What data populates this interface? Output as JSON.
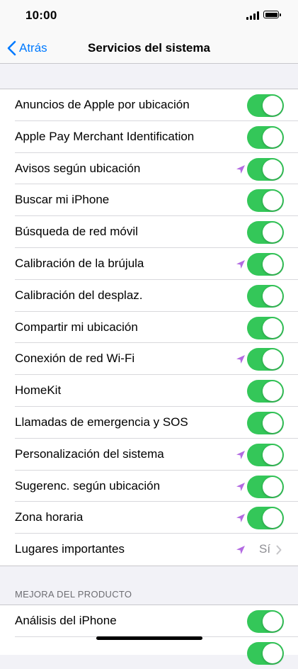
{
  "status": {
    "time": "10:00"
  },
  "nav": {
    "back_label": "Atrás",
    "title": "Servicios del sistema"
  },
  "colors": {
    "accent": "#007aff",
    "toggle_on": "#34c759",
    "location_arrow": "#b36ae2"
  },
  "settings": [
    {
      "label": "Anuncios de Apple por ubicación",
      "on": true,
      "location_icon": false
    },
    {
      "label": "Apple Pay Merchant Identification",
      "on": true,
      "location_icon": false
    },
    {
      "label": "Avisos según ubicación",
      "on": true,
      "location_icon": true
    },
    {
      "label": "Buscar mi iPhone",
      "on": true,
      "location_icon": false
    },
    {
      "label": "Búsqueda de red móvil",
      "on": true,
      "location_icon": false
    },
    {
      "label": "Calibración de la brújula",
      "on": true,
      "location_icon": true
    },
    {
      "label": "Calibración del desplaz.",
      "on": true,
      "location_icon": false
    },
    {
      "label": "Compartir mi ubicación",
      "on": true,
      "location_icon": false
    },
    {
      "label": "Conexión de red Wi-Fi",
      "on": true,
      "location_icon": true
    },
    {
      "label": "HomeKit",
      "on": true,
      "location_icon": false
    },
    {
      "label": "Llamadas de emergencia y SOS",
      "on": true,
      "location_icon": false
    },
    {
      "label": "Personalización del sistema",
      "on": true,
      "location_icon": true
    },
    {
      "label": "Sugerenc. según ubicación",
      "on": true,
      "location_icon": true
    },
    {
      "label": "Zona horaria",
      "on": true,
      "location_icon": true
    }
  ],
  "important_locations": {
    "label": "Lugares importantes",
    "value": "Sí"
  },
  "product_section": {
    "header": "MEJORA DEL PRODUCTO",
    "items": [
      {
        "label": "Análisis del iPhone",
        "on": true
      }
    ]
  }
}
